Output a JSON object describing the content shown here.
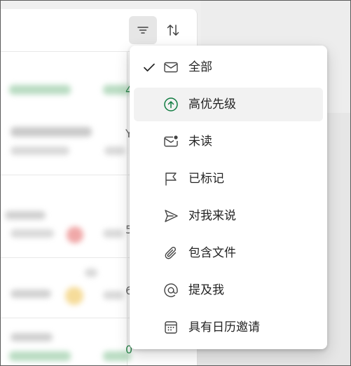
{
  "toolbar": {
    "filter_icon": "filter-lines-icon",
    "sort_icon": "sort-arrows-icon"
  },
  "background": {
    "partial_chars": [
      "Y",
      "5",
      "6",
      "0",
      "4"
    ]
  },
  "filter_menu": {
    "items": [
      {
        "label": "全部",
        "icon": "mail-icon",
        "checked": true,
        "highlighted": false
      },
      {
        "label": "高优先级",
        "icon": "arrow-up-circle-icon",
        "checked": false,
        "highlighted": true
      },
      {
        "label": "未读",
        "icon": "mail-unread-icon",
        "checked": false,
        "highlighted": false
      },
      {
        "label": "已标记",
        "icon": "flag-icon",
        "checked": false,
        "highlighted": false
      },
      {
        "label": "对我来说",
        "icon": "send-icon",
        "checked": false,
        "highlighted": false
      },
      {
        "label": "包含文件",
        "icon": "attach-icon",
        "checked": false,
        "highlighted": false
      },
      {
        "label": "提及我",
        "icon": "mention-icon",
        "checked": false,
        "highlighted": false
      },
      {
        "label": "具有日历邀请",
        "icon": "calendar-icon",
        "checked": false,
        "highlighted": false
      }
    ]
  },
  "colors": {
    "accent_green": "#107c41",
    "menu_hover": "#f2f2f2",
    "toolbar_active": "#e6e6e6"
  }
}
